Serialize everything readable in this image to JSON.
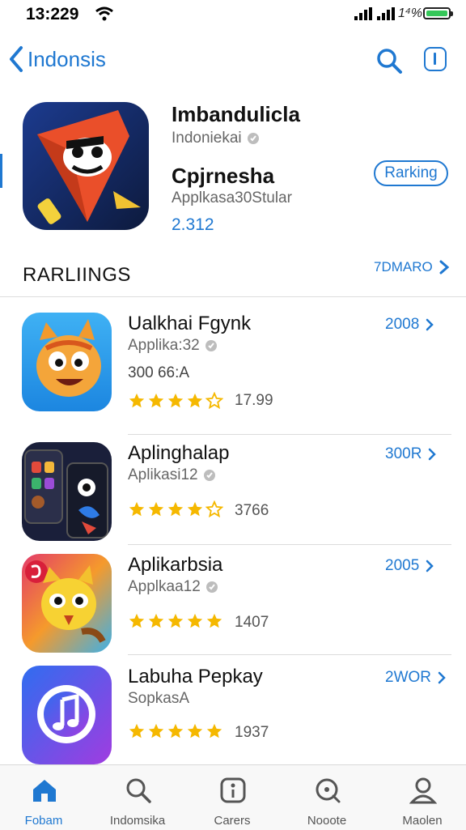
{
  "status_bar": {
    "time": "13:229",
    "battery_text": "1⁴%"
  },
  "nav": {
    "back_label": "Indonsis"
  },
  "featured": {
    "title": "Imbandulicla",
    "subtitle": "Indoniekai",
    "title2": "Cpjrnesha",
    "subtitle2": "Applkasa30Stular",
    "count": "2.312",
    "rank_button": "Rarking"
  },
  "section": {
    "heading": "RARLIINGS",
    "more_label": "7DMARO"
  },
  "apps": [
    {
      "name": "Ualkhai Fgynk",
      "category": "Applika:32",
      "extra": "300 66:A",
      "rating": 4,
      "rating_count": "17.99",
      "action": "2008"
    },
    {
      "name": "Aplinghalap",
      "category": "Aplikasi12",
      "extra": "",
      "rating": 4,
      "rating_count": "3766",
      "action": "300R"
    },
    {
      "name": "Aplikarbsia",
      "category": "Applkaa12",
      "extra": "",
      "rating": 5,
      "rating_count": "1407",
      "action": "2005"
    },
    {
      "name": "Labuha Pepkay",
      "category": "SopkasA",
      "extra": "",
      "rating": 5,
      "rating_count": "1937",
      "action": "2WOR"
    }
  ],
  "tabs": [
    {
      "label": "Fobam",
      "icon": "home-icon",
      "active": true
    },
    {
      "label": "Indomsika",
      "icon": "search-icon",
      "active": false
    },
    {
      "label": "Carers",
      "icon": "apps-icon",
      "active": false
    },
    {
      "label": "Nooote",
      "icon": "updates-icon",
      "active": false
    },
    {
      "label": "Maolen",
      "icon": "profile-icon",
      "active": false
    }
  ],
  "colors": {
    "accent": "#1f78d1",
    "star": "#f5b800",
    "active_tab": "#1f78d1"
  }
}
